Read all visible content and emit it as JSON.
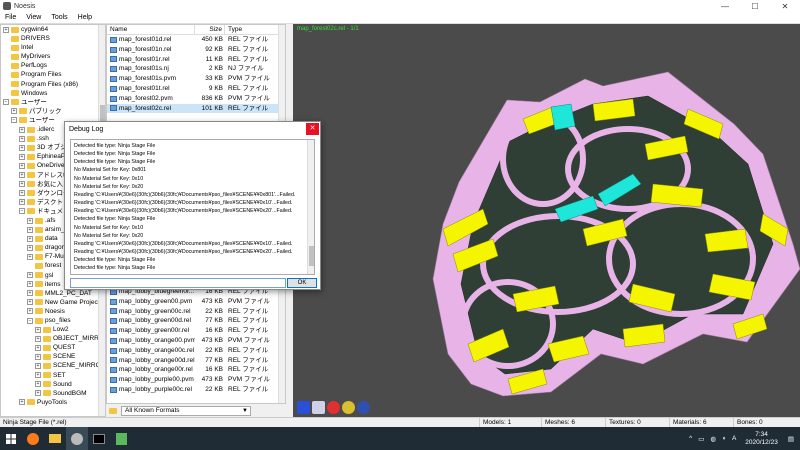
{
  "window": {
    "title": "Noesis"
  },
  "menu": [
    "File",
    "View",
    "Tools",
    "Help"
  ],
  "tree": [
    {
      "label": "cygwin64",
      "indent": 0,
      "exp": "+"
    },
    {
      "label": "DRIVERS",
      "indent": 0,
      "exp": ""
    },
    {
      "label": "Intel",
      "indent": 0,
      "exp": ""
    },
    {
      "label": "MyDrivers",
      "indent": 0,
      "exp": ""
    },
    {
      "label": "PerfLogs",
      "indent": 0,
      "exp": ""
    },
    {
      "label": "Program Files",
      "indent": 0,
      "exp": ""
    },
    {
      "label": "Program Files (x86)",
      "indent": 0,
      "exp": ""
    },
    {
      "label": "Windows",
      "indent": 0,
      "exp": ""
    },
    {
      "label": "ユーザー",
      "indent": 0,
      "exp": "−"
    },
    {
      "label": "パブリック",
      "indent": 1,
      "exp": "+"
    },
    {
      "label": "ユーザー",
      "indent": 1,
      "exp": "−"
    },
    {
      "label": ".idlerc",
      "indent": 2,
      "exp": "+"
    },
    {
      "label": ".ssh",
      "indent": 2,
      "exp": "+"
    },
    {
      "label": "3D オブジェクト",
      "indent": 2,
      "exp": "+"
    },
    {
      "label": "EphineaPSO",
      "indent": 2,
      "exp": "+"
    },
    {
      "label": "OneDrive",
      "indent": 2,
      "exp": "+"
    },
    {
      "label": "アドレス帳",
      "indent": 2,
      "exp": "+"
    },
    {
      "label": "お気に入り",
      "indent": 2,
      "exp": "+"
    },
    {
      "label": "ダウンロード",
      "indent": 2,
      "exp": "+"
    },
    {
      "label": "デスクトップ",
      "indent": 2,
      "exp": "+"
    },
    {
      "label": "ドキュメント",
      "indent": 2,
      "exp": "−"
    },
    {
      "label": ".afs",
      "indent": 3,
      "exp": "+"
    },
    {
      "label": "arsim_test",
      "indent": 3,
      "exp": "+"
    },
    {
      "label": "data",
      "indent": 3,
      "exp": "+"
    },
    {
      "label": "dragon",
      "indent": 3,
      "exp": "+"
    },
    {
      "label": "F7-Multi-",
      "indent": 3,
      "exp": "+"
    },
    {
      "label": "forest",
      "indent": 3,
      "exp": ""
    },
    {
      "label": "gsl",
      "indent": 3,
      "exp": "+"
    },
    {
      "label": "items",
      "indent": 3,
      "exp": "+"
    },
    {
      "label": "MML2_PC_DAT",
      "indent": 3,
      "exp": "+"
    },
    {
      "label": "New Game Project",
      "indent": 3,
      "exp": "+"
    },
    {
      "label": "Noesis",
      "indent": 3,
      "exp": "+"
    },
    {
      "label": "pso_files",
      "indent": 3,
      "exp": "−"
    },
    {
      "label": "Low2",
      "indent": 4,
      "exp": "+"
    },
    {
      "label": "OBJECT_MIRROR",
      "indent": 4,
      "exp": "+"
    },
    {
      "label": "QUEST",
      "indent": 4,
      "exp": "+"
    },
    {
      "label": "SCENE",
      "indent": 4,
      "exp": "+"
    },
    {
      "label": "SCENE_MIRROR",
      "indent": 4,
      "exp": "+"
    },
    {
      "label": "SET",
      "indent": 4,
      "exp": "+"
    },
    {
      "label": "Sound",
      "indent": 4,
      "exp": "+"
    },
    {
      "label": "SoundBGM",
      "indent": 4,
      "exp": "+"
    },
    {
      "label": "PuyoTools",
      "indent": 2,
      "exp": "+"
    }
  ],
  "files": {
    "headers": {
      "name": "Name",
      "size": "Size",
      "type": "Type"
    },
    "rows_top": [
      {
        "name": "map_forest01d.rel",
        "size": "450 KB",
        "type": "REL ファイル"
      },
      {
        "name": "map_forest01n.rel",
        "size": "92 KB",
        "type": "REL ファイル"
      },
      {
        "name": "map_forest01r.rel",
        "size": "11 KB",
        "type": "REL ファイル"
      },
      {
        "name": "map_forest01s.nj",
        "size": "2 KB",
        "type": "NJ ファイル"
      },
      {
        "name": "map_forest01s.pvm",
        "size": "33 KB",
        "type": "PVM ファイル"
      },
      {
        "name": "map_forest01t.rel",
        "size": "9 KB",
        "type": "REL ファイル"
      },
      {
        "name": "map_forest02.pvm",
        "size": "836 KB",
        "type": "PVM ファイル"
      },
      {
        "name": "map_forest02c.rel",
        "size": "101 KB",
        "type": "REL ファイル",
        "selected": true
      }
    ],
    "rows_bottom": [
      {
        "name": "map_lobby_bluegreen0r...",
        "size": "16 KB",
        "type": "REL ファイル"
      },
      {
        "name": "map_lobby_green00.pvm",
        "size": "473 KB",
        "type": "PVM ファイル"
      },
      {
        "name": "map_lobby_green00c.rel",
        "size": "22 KB",
        "type": "REL ファイル"
      },
      {
        "name": "map_lobby_green00d.rel",
        "size": "77 KB",
        "type": "REL ファイル"
      },
      {
        "name": "map_lobby_green00r.rel",
        "size": "16 KB",
        "type": "REL ファイル"
      },
      {
        "name": "map_lobby_orange00.pvm",
        "size": "473 KB",
        "type": "PVM ファイル"
      },
      {
        "name": "map_lobby_orange00c.rel",
        "size": "22 KB",
        "type": "REL ファイル"
      },
      {
        "name": "map_lobby_orange00d.rel",
        "size": "77 KB",
        "type": "REL ファイル"
      },
      {
        "name": "map_lobby_orange00r.rel",
        "size": "16 KB",
        "type": "REL ファイル"
      },
      {
        "name": "map_lobby_purple00.pvm",
        "size": "473 KB",
        "type": "PVM ファイル"
      },
      {
        "name": "map_lobby_purple00c.rel",
        "size": "22 KB",
        "type": "REL ファイル"
      }
    ],
    "filter": "All Known Formats"
  },
  "viewport": {
    "label": "map_forest02c.rel - 1/1"
  },
  "dialog": {
    "title": "Debug Log",
    "ok_label": "OK",
    "lines": [
      "Detected file type: Ninja Stage File",
      "Detected file type: Ninja Stage File",
      "Detected file type: Ninja Stage File",
      "No Material Set for Key:  0x801",
      "No Material Set for Key:  0x10",
      "No Material Set for Key:  0x20",
      "Reading 'C:¥Users¥(30e6)(30fc)(30b6)(30fc)¥Documents¥pso_files¥SCENE¥¥0x801'...Failed.",
      "Reading 'C:¥Users¥(30e6)(30fc)(30b6)(30fc)¥Documents¥pso_files¥SCENE¥¥0x10'...Failed.",
      "Reading 'C:¥Users¥(30e6)(30fc)(30b6)(30fc)¥Documents¥pso_files¥SCENE¥¥0x20'...Failed.",
      "Detected file type: Ninja Stage File",
      "No Material Set for Key:  0x10",
      "No Material Set for Key:  0x20",
      "Reading 'C:¥Users¥(30e6)(30fc)(30b6)(30fc)¥Documents¥pso_files¥SCENE¥¥0x10'...Failed.",
      "Reading 'C:¥Users¥(30e6)(30fc)(30b6)(30fc)¥Documents¥pso_files¥SCENE¥¥0x20'...Failed.",
      "Detected file type: Ninja Stage File",
      "Detected file type: Ninja Stage File",
      "Detected file type: Ninja Stage File",
      "Detected file type: Ninja Stage File"
    ]
  },
  "status": {
    "file_type": "Ninja Stage File (*.rel)",
    "models": "Models: 1",
    "meshes": "Meshes: 6",
    "textures": "Textures: 0",
    "materials": "Materials: 6",
    "bones": "Bones: 0"
  },
  "taskbar": {
    "time": "7:34",
    "date": "2020/12/23",
    "ime": "A"
  },
  "colors": {
    "wall": "#e8b4e8",
    "yellow": "#f5f500",
    "cyan": "#1ee6d8",
    "floor": "#2f3f35",
    "bg": "#4b4b4b"
  }
}
